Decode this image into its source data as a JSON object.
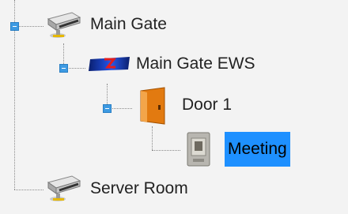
{
  "tree": {
    "nodes": [
      {
        "label": "Main Gate",
        "icon": "network-hub-icon",
        "expanded": true
      },
      {
        "label": "Main Gate EWS",
        "icon": "controller-device-icon",
        "expanded": true
      },
      {
        "label": "Door 1",
        "icon": "door-icon",
        "expanded": true
      },
      {
        "label": "Meeting",
        "icon": "card-reader-icon",
        "selected": true
      },
      {
        "label": "Server Room",
        "icon": "network-hub-icon",
        "expanded": false
      }
    ]
  },
  "colors": {
    "background": "#f3f3f3",
    "selection": "#1e90ff",
    "expander": "#3d9ae2",
    "connector": "#8a8a8a"
  }
}
